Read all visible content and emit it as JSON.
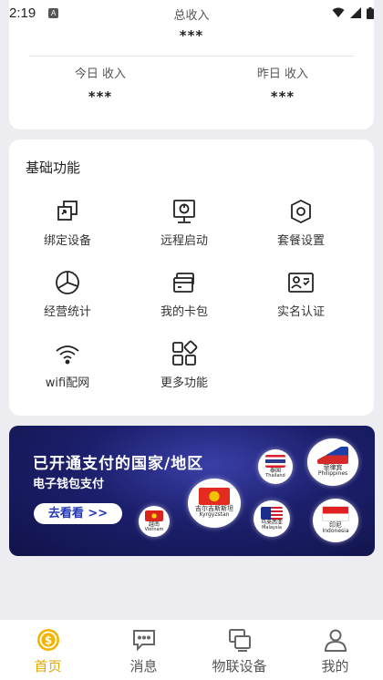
{
  "status_bar": {
    "time": "2:19",
    "notification_letter": "A"
  },
  "income": {
    "total_label": "总收入",
    "total_value": "***",
    "today_label": "今日 收入",
    "today_value": "***",
    "yesterday_label": "昨日 收入",
    "yesterday_value": "***"
  },
  "functions": {
    "title": "基础功能",
    "items": [
      {
        "label": "绑定设备",
        "icon": "bind-device-icon"
      },
      {
        "label": "远程启动",
        "icon": "remote-start-icon"
      },
      {
        "label": "套餐设置",
        "icon": "package-settings-icon"
      },
      {
        "label": "经营统计",
        "icon": "pie-chart-icon"
      },
      {
        "label": "我的卡包",
        "icon": "card-wallet-icon"
      },
      {
        "label": "实名认证",
        "icon": "id-card-icon"
      },
      {
        "label": "wifi配网",
        "icon": "wifi-icon"
      },
      {
        "label": "更多功能",
        "icon": "more-grid-icon"
      }
    ]
  },
  "banner": {
    "title": "已开通支付的国家/地区",
    "subtitle": "电子钱包支付",
    "button": "去看看 >>",
    "flags": [
      {
        "cn": "泰国",
        "en": "Thailand"
      },
      {
        "cn": "菲律宾",
        "en": "Philippines"
      },
      {
        "cn": "吉尔吉斯斯坦",
        "en": "Kyrgyzstan"
      },
      {
        "cn": "越南",
        "en": "Vietnam"
      },
      {
        "cn": "马来西亚",
        "en": "Malaysia"
      },
      {
        "cn": "印尼",
        "en": "Indonesia"
      }
    ]
  },
  "tabs": [
    {
      "label": "首页",
      "icon": "home-dollar-icon",
      "active": true
    },
    {
      "label": "消息",
      "icon": "message-icon",
      "active": false
    },
    {
      "label": "物联设备",
      "icon": "iot-device-icon",
      "active": false
    },
    {
      "label": "我的",
      "icon": "profile-icon",
      "active": false
    }
  ],
  "colors": {
    "accent": "#e0a800",
    "banner_bg": "#1c1f6b",
    "button_text": "#2438b8"
  }
}
